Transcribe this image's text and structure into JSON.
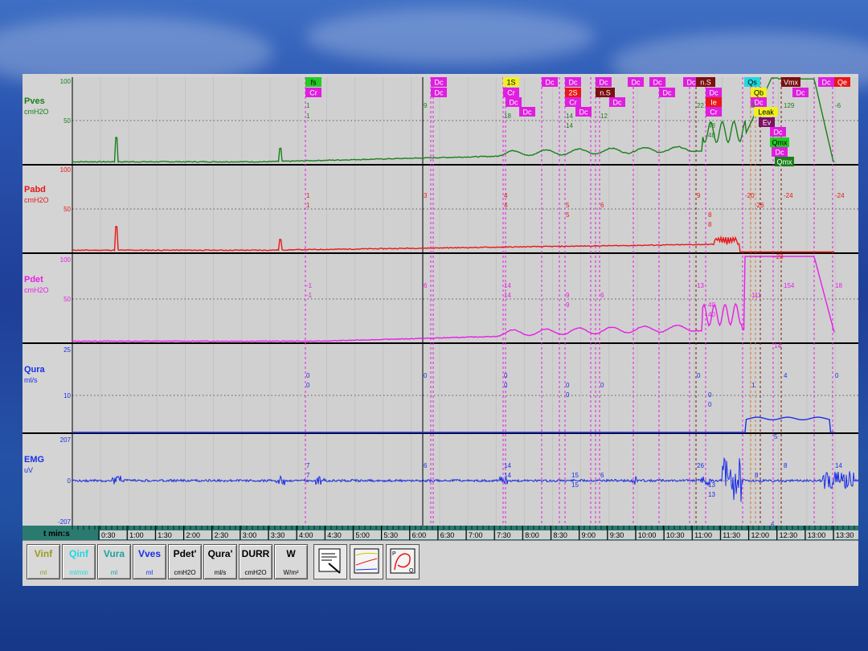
{
  "colors": {
    "pves": "#1a7f1a",
    "pabd": "#e81818",
    "pdet": "#e81ee8",
    "qura": "#1a2ee8",
    "emg": "#1a2ee8",
    "timebar": "#2a7a70",
    "event_marker": "#e01ee0"
  },
  "channels": [
    {
      "id": "pves",
      "name": "Pves",
      "unit": "cmH2O",
      "top": "100",
      "mid": "50",
      "bottom": ""
    },
    {
      "id": "pabd",
      "name": "Pabd",
      "unit": "cmH2O",
      "top": "100",
      "mid": "50",
      "bottom": ""
    },
    {
      "id": "pdet",
      "name": "Pdet",
      "unit": "cmH2O",
      "top": "100",
      "mid": "50",
      "bottom": ""
    },
    {
      "id": "qura",
      "name": "Qura",
      "unit": "ml/s",
      "top": "25",
      "mid": "10",
      "bottom": ""
    },
    {
      "id": "emg",
      "name": "EMG",
      "unit": "uV",
      "top": "207",
      "mid": "0",
      "bottom": "-207"
    }
  ],
  "time_axis": {
    "label": "t min:s",
    "ticks": [
      "0:30",
      "1:00",
      "1:30",
      "2:00",
      "2:30",
      "3:00",
      "3:30",
      "4:00",
      "4:30",
      "5:00",
      "5:30",
      "6:00",
      "6:30",
      "7:00",
      "7:30",
      "8:00",
      "8:30",
      "9:00",
      "9:30",
      "10:00",
      "10:30",
      "11:00",
      "11:30",
      "12:00",
      "12:30",
      "13:00",
      "13:30"
    ]
  },
  "event_tags": [
    {
      "text": "fs",
      "color": "#22cc22",
      "fg": "#000"
    },
    {
      "text": "Cr",
      "color": "#e01ee0",
      "fg": "#fff"
    },
    {
      "text": "Dc",
      "color": "#e01ee0",
      "fg": "#fff"
    },
    {
      "text": "Dc",
      "color": "#e01ee0",
      "fg": "#fff"
    },
    {
      "text": "1S",
      "color": "#f0f020",
      "fg": "#000"
    },
    {
      "text": "Cr",
      "color": "#e01ee0",
      "fg": "#fff"
    },
    {
      "text": "Dc",
      "color": "#e01ee0",
      "fg": "#fff"
    },
    {
      "text": "Dc",
      "color": "#e01ee0",
      "fg": "#fff"
    },
    {
      "text": "Dc",
      "color": "#e01ee0",
      "fg": "#fff"
    },
    {
      "text": "Dc",
      "color": "#e01ee0",
      "fg": "#fff"
    },
    {
      "text": "2S",
      "color": "#e81818",
      "fg": "#fff"
    },
    {
      "text": "Cr",
      "color": "#e01ee0",
      "fg": "#fff"
    },
    {
      "text": "Dc",
      "color": "#e01ee0",
      "fg": "#fff"
    },
    {
      "text": "Dc",
      "color": "#e01ee0",
      "fg": "#fff"
    },
    {
      "text": "n.S",
      "color": "#7a1010",
      "fg": "#fff"
    },
    {
      "text": "Dc",
      "color": "#e01ee0",
      "fg": "#fff"
    },
    {
      "text": "Dc",
      "color": "#e01ee0",
      "fg": "#fff"
    },
    {
      "text": "Dc",
      "color": "#e01ee0",
      "fg": "#fff"
    },
    {
      "text": "Dc",
      "color": "#e01ee0",
      "fg": "#fff"
    },
    {
      "text": "Dc",
      "color": "#e01ee0",
      "fg": "#fff"
    },
    {
      "text": "n.S",
      "color": "#7a1010",
      "fg": "#fff"
    },
    {
      "text": "Dc",
      "color": "#e01ee0",
      "fg": "#fff"
    },
    {
      "text": "Ie",
      "color": "#e81818",
      "fg": "#fff"
    },
    {
      "text": "Cr",
      "color": "#e01ee0",
      "fg": "#fff"
    },
    {
      "text": "Qs",
      "color": "#20d8e0",
      "fg": "#000"
    },
    {
      "text": "Qb",
      "color": "#f0f020",
      "fg": "#000"
    },
    {
      "text": "Dc",
      "color": "#e01ee0",
      "fg": "#fff"
    },
    {
      "text": "Leak",
      "color": "#f0f020",
      "fg": "#000"
    },
    {
      "text": "Ev",
      "color": "#7a1060",
      "fg": "#fff"
    },
    {
      "text": "Dc",
      "color": "#e01ee0",
      "fg": "#fff"
    },
    {
      "text": "Qmx",
      "color": "#22cc22",
      "fg": "#000"
    },
    {
      "text": "Dc",
      "color": "#e01ee0",
      "fg": "#fff"
    },
    {
      "text": "Qmx",
      "color": "#1a7f1a",
      "fg": "#fff"
    },
    {
      "text": "Vmx",
      "color": "#7a1010",
      "fg": "#fff"
    },
    {
      "text": "Dc",
      "color": "#e01ee0",
      "fg": "#fff"
    },
    {
      "text": "Dc",
      "color": "#e01ee0",
      "fg": "#fff"
    },
    {
      "text": "Dc",
      "color": "#e01ee0",
      "fg": "#fff"
    },
    {
      "text": "Qe",
      "color": "#e81818",
      "fg": "#fff"
    }
  ],
  "value_labels": {
    "pves": [
      "1",
      "1",
      "9",
      "18",
      "14",
      "14",
      "12",
      "22",
      "48",
      "48",
      "3",
      "129",
      "-6"
    ],
    "pabd": [
      "1",
      "1",
      "3",
      "4",
      "4",
      "5",
      "5",
      "6",
      "9",
      "8",
      "8",
      "-20",
      "-26",
      "-24",
      "-24",
      "-23"
    ],
    "pdet": [
      "-1",
      "-1",
      "6",
      "14",
      "14",
      "9",
      "9",
      "6",
      "13",
      "40",
      "40",
      "111",
      "154",
      "18",
      "14"
    ],
    "qura": [
      "0",
      "0",
      "0",
      "0",
      "0",
      "0",
      "0",
      "0",
      "0",
      "0",
      "0",
      "1",
      "4",
      "0",
      "5"
    ],
    "emg": [
      "7",
      "7",
      "6",
      "14",
      "14",
      "15",
      "15",
      "6",
      "26",
      "13",
      "13",
      "8",
      "8",
      "14",
      "6"
    ]
  },
  "toolbar": [
    {
      "label": "Vinf",
      "unit": "ml",
      "color": "#9a9a20"
    },
    {
      "label": "Qinf",
      "unit": "ml/min",
      "color": "#20d8e0"
    },
    {
      "label": "Vura",
      "unit": "ml",
      "color": "#20a0a0"
    },
    {
      "label": "Vves",
      "unit": "ml",
      "color": "#1a2ee8"
    },
    {
      "label": "Pdet'",
      "unit": "cmH2O",
      "color": "#000"
    },
    {
      "label": "Qura'",
      "unit": "ml/s",
      "color": "#000"
    },
    {
      "label": "DURR",
      "unit": "cmH2O",
      "color": "#000"
    },
    {
      "label": "W",
      "unit": "W/m²",
      "color": "#000"
    }
  ],
  "icons": [
    "notes-icon",
    "chart-overview-icon",
    "pressure-flow-plot-icon"
  ]
}
